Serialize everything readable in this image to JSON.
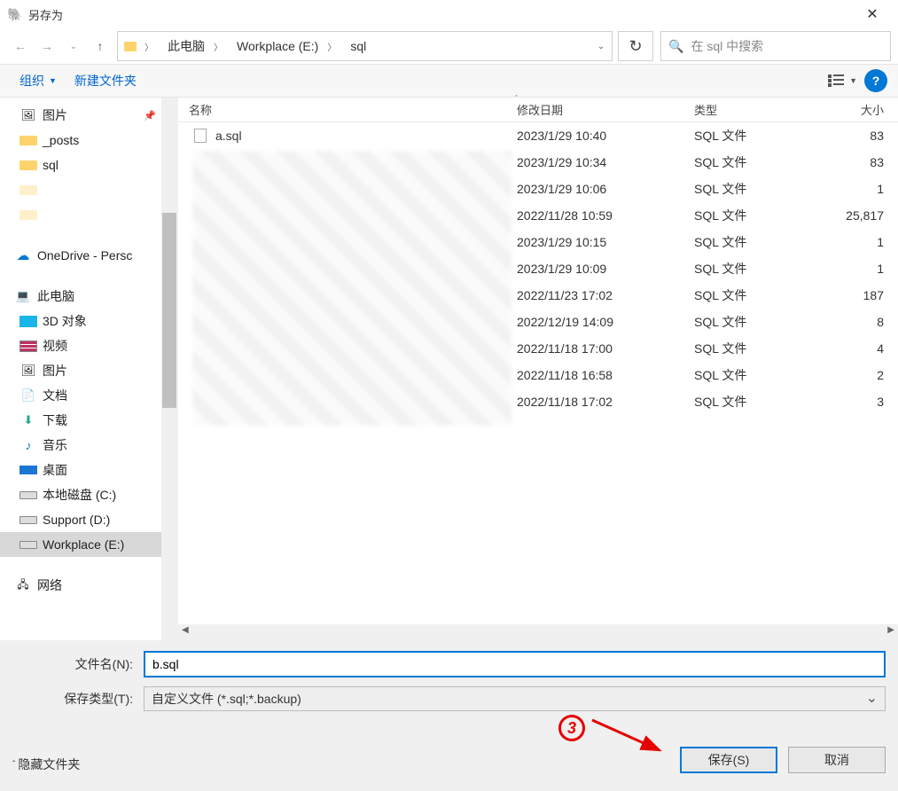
{
  "titlebar": {
    "title": "另存为"
  },
  "nav": {
    "crumbs": [
      "此电脑",
      "Workplace (E:)",
      "sql"
    ],
    "search_placeholder": "在 sql 中搜索"
  },
  "toolbar": {
    "organize": "组织",
    "newfolder": "新建文件夹"
  },
  "sidebar": {
    "items": [
      {
        "label": "图片",
        "icon": "img",
        "lv": 1,
        "pinned": true
      },
      {
        "label": "_posts",
        "icon": "folder-y",
        "lv": 1
      },
      {
        "label": "sql",
        "icon": "folder-y",
        "lv": 1
      },
      {
        "label": "",
        "icon": "folder-blank",
        "lv": 1
      },
      {
        "label": "",
        "icon": "folder-blank",
        "lv": 1
      },
      {
        "label": "OneDrive - Persc",
        "icon": "onedrive",
        "lv": 0,
        "gap": true
      },
      {
        "label": "此电脑",
        "icon": "pc",
        "lv": 0,
        "gap": true
      },
      {
        "label": "3D 对象",
        "icon": "3d",
        "lv": 1
      },
      {
        "label": "视频",
        "icon": "vid",
        "lv": 1
      },
      {
        "label": "图片",
        "icon": "img",
        "lv": 1
      },
      {
        "label": "文档",
        "icon": "doc",
        "lv": 1
      },
      {
        "label": "下载",
        "icon": "dl",
        "lv": 1
      },
      {
        "label": "音乐",
        "icon": "music",
        "lv": 1
      },
      {
        "label": "桌面",
        "icon": "desk",
        "lv": 1
      },
      {
        "label": "本地磁盘 (C:)",
        "icon": "drive",
        "lv": 1
      },
      {
        "label": "Support (D:)",
        "icon": "drive",
        "lv": 1
      },
      {
        "label": "Workplace (E:)",
        "icon": "drive",
        "lv": 1,
        "selected": true
      },
      {
        "label": "网络",
        "icon": "net",
        "lv": 0,
        "gap": true
      }
    ]
  },
  "filelist": {
    "headers": {
      "name": "名称",
      "date": "修改日期",
      "type": "类型",
      "size": "大小"
    },
    "rows": [
      {
        "name": "a.sql",
        "date": "2023/1/29 10:40",
        "type": "SQL 文件",
        "size": "83"
      },
      {
        "name": "",
        "date": "2023/1/29 10:34",
        "type": "SQL 文件",
        "size": "83"
      },
      {
        "name": "",
        "date": "2023/1/29 10:06",
        "type": "SQL 文件",
        "size": "1"
      },
      {
        "name": "",
        "date": "2022/11/28 10:59",
        "type": "SQL 文件",
        "size": "25,817"
      },
      {
        "name": "",
        "date": "2023/1/29 10:15",
        "type": "SQL 文件",
        "size": "1"
      },
      {
        "name": "",
        "date": "2023/1/29 10:09",
        "type": "SQL 文件",
        "size": "1"
      },
      {
        "name": "",
        "date": "2022/11/23 17:02",
        "type": "SQL 文件",
        "size": "187"
      },
      {
        "name": "",
        "date": "2022/12/19 14:09",
        "type": "SQL 文件",
        "size": "8"
      },
      {
        "name": "",
        "date": "2022/11/18 17:00",
        "type": "SQL 文件",
        "size": "4"
      },
      {
        "name": "",
        "date": "2022/11/18 16:58",
        "type": "SQL 文件",
        "size": "2"
      },
      {
        "name": "",
        "date": "2022/11/18 17:02",
        "type": "SQL 文件",
        "size": "3"
      }
    ]
  },
  "bottom": {
    "filename_label": "文件名(N):",
    "filename_value": "b.sql",
    "savetype_label": "保存类型(T):",
    "savetype_value": "自定义文件 (*.sql;*.backup)",
    "hide_folders": "隐藏文件夹",
    "save": "保存(S)",
    "cancel": "取消"
  },
  "annotation": {
    "number": "3"
  }
}
